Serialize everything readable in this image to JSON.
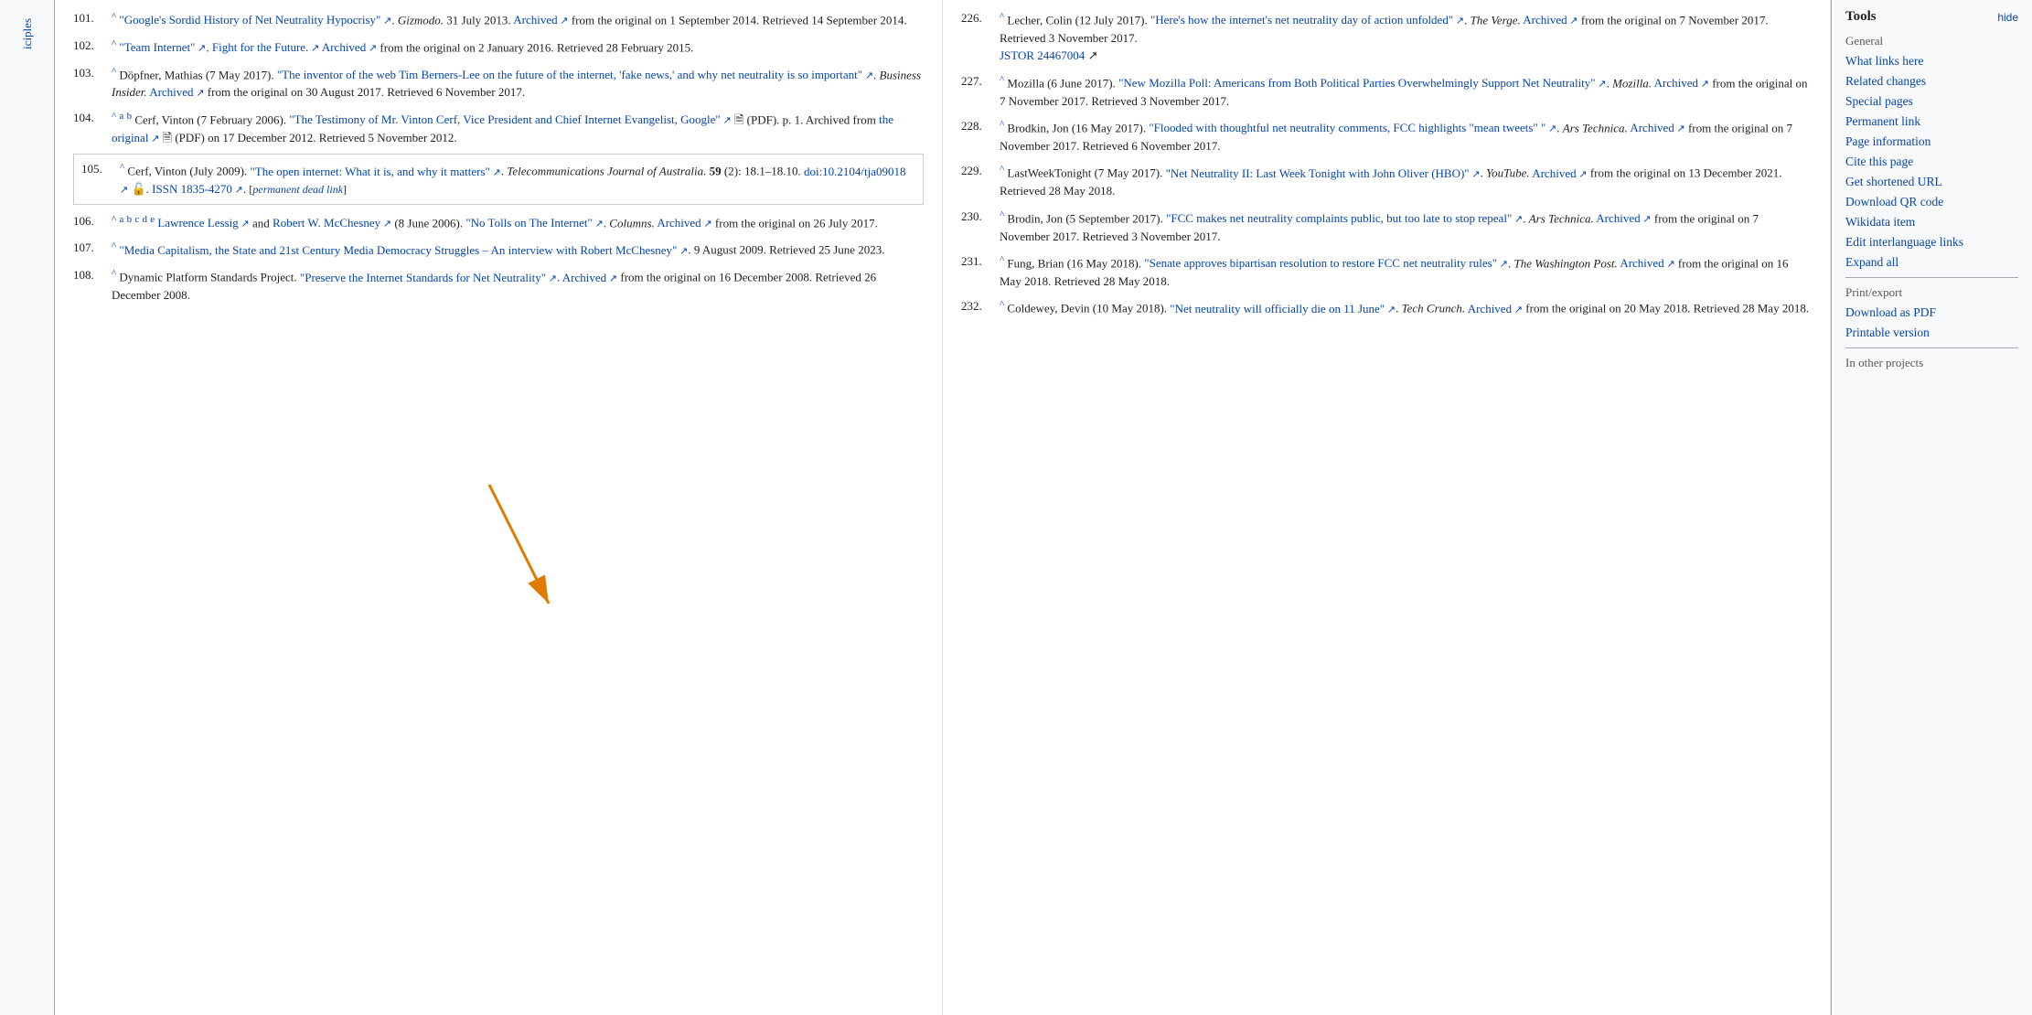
{
  "sidebar_left": {
    "label": "iciples"
  },
  "refs_left": [
    {
      "num": "101.",
      "sup": "^",
      "content": "\"Google's Sordid History of Net Neutrality Hypocrisy\"",
      "content_link": true,
      "italic_source": "Gizmodo.",
      "date": "31 July 2013.",
      "archived": "Archived",
      "archived_text": " from the original on 1 September 2014. Retrieved 14 September 2014."
    },
    {
      "num": "102.",
      "sup": "^",
      "content": "\"Team Internet\"",
      "italic_source": "",
      "extra": "Fight for the Future.",
      "archived": "Archived",
      "archived_text": " from the original on 2 January 2016. Retrieved 28 February 2015."
    },
    {
      "num": "103.",
      "sup": "^",
      "authors": "Döpfner, Mathias (7 May 2017).",
      "content": "\"The inventor of the web Tim Berners-Lee on the future of the internet, 'fake news,' and why net neutrality is so important\"",
      "italic_source": "Business Insider.",
      "archived": "Archived",
      "archived_text": " from the original on 30 August 2017. Retrieved 6 November 2017."
    },
    {
      "num": "104.",
      "sup": "^",
      "sup_letters": "a b",
      "authors": "Cerf, Vinton (7 February 2006).",
      "content": "\"The Testimony of Mr. Vinton Cerf, Vice President and Chief Internet Evangelist, Google\"",
      "pdf_note": "(PDF). p. 1.",
      "archived": "Archived from the",
      "original_link": "the original",
      "archived_text": "(PDF) on 17 December 2012. Retrieved 5 November 2012."
    },
    {
      "num": "105.",
      "highlighted": true,
      "sup": "^",
      "authors": "Cerf, Vinton (July 2009).",
      "content": "\"The open internet: What it is, and why it matters\"",
      "italic_source": "Telecommunications Journal of Australia.",
      "bold_vol": "59",
      "issue_pages": "(2): 18.1–18.10.",
      "doi": "doi:10.2104/tja09018",
      "issn": "ISSN 1835-4270",
      "dead_link": "permanent dead link"
    },
    {
      "num": "106.",
      "sup": "^",
      "sup_letters": "a b c d e",
      "authors1_link": "Lawrence Lessig",
      "authors2_link": "Robert W. McChesney",
      "date": "(8 June 2006).",
      "content": "\"No Tolls on The Internet\"",
      "italic_source": "Columns.",
      "archived": "Archived",
      "archived_text": " from the original on 26 July 2017."
    },
    {
      "num": "107.",
      "sup": "^",
      "content": "\"Media Capitalism, the State and 21st Century Media Democracy Struggles – An interview with Robert McChesney\"",
      "date": ". 9 August 2009. Retrieved 25 June 2023."
    },
    {
      "num": "108.",
      "sup": "^",
      "authors": "Dynamic Platform Standards Project.",
      "content": "\"Preserve the Internet Standards for Net Neutrality\"",
      "archived": "Archived",
      "archived_text": " from the original on 16 December 2008. Retrieved 26 December 2008."
    }
  ],
  "refs_right": [
    {
      "num": "226.",
      "sup": "^",
      "authors": "Lecher, Colin (12 July 2017).",
      "content": "\"Here's how the internet's net neutrality day of action unfolded\"",
      "italic_source": "The Verge.",
      "archived": "Archived",
      "archived_text": " from the original on 7 November 2017. Retrieved 3 November 2017.",
      "jstor": "JSTOR 24467004"
    },
    {
      "num": "227.",
      "sup": "^",
      "authors": "Mozilla (6 June 2017).",
      "content": "\"New Mozilla Poll: Americans from Both Political Parties Overwhelmingly Support Net Neutrality\"",
      "italic_source": "Mozilla.",
      "archived": "Archived",
      "archived_text": " from the original on 7 November 2017. Retrieved 3 November 2017."
    },
    {
      "num": "228.",
      "sup": "^",
      "authors": "Brodkin, Jon (16 May 2017).",
      "content": "\"Flooded with thoughtful net neutrality comments, FCC highlights \"mean tweets\" \"",
      "italic_source": "Ars Technica.",
      "archived": "Archived",
      "archived_text": " from the original on 7 November 2017. Retrieved 6 November 2017."
    },
    {
      "num": "229.",
      "sup": "^",
      "authors": "LastWeekTonight (7 May 2017).",
      "content": "\"Net Neutrality II: Last Week Tonight with John Oliver (HBO)\"",
      "italic_source": "YouTube.",
      "archived": "Archived",
      "archived_text": " from the original on 13 December 2021. Retrieved 28 May 2018."
    },
    {
      "num": "230.",
      "sup": "^",
      "authors": "Brodin, Jon (5 September 2017).",
      "content": "\"FCC makes net neutrality complaints public, but too late to stop repeal\"",
      "italic_source": "Ars Technica.",
      "archived": "Archived",
      "archived_text": " from the original on 7 November 2017. Retrieved 3 November 2017."
    },
    {
      "num": "231.",
      "sup": "^",
      "authors": "Fung, Brian (16 May 2018).",
      "content": "\"Senate approves bipartisan resolution to restore FCC net neutrality rules\"",
      "italic_source": "The Washington Post.",
      "archived": "Archived",
      "archived_text": " from the original on 16 May 2018. Retrieved 28 May 2018."
    },
    {
      "num": "232.",
      "sup": "^",
      "authors": "Coldewey, Devin (10 May 2018).",
      "content": "\"Net neutrality will officially die on 11 June\"",
      "italic_source": "Tech Crunch.",
      "archived": "Archived",
      "archived_text": " from the original on 20 May 2018. Retrieved 28 May 2018.",
      "truncated": true
    }
  ],
  "tools": {
    "title": "Tools",
    "hide_label": "hide",
    "general_label": "General",
    "links": [
      "What links here",
      "Related changes",
      "Special pages",
      "Permanent link",
      "Page information",
      "Cite this page",
      "Get shortened URL",
      "Download QR code",
      "Wikidata item",
      "Edit interlanguage links",
      "Expand all"
    ],
    "print_section": "Print/export",
    "print_links": [
      "Download as PDF",
      "Printable version"
    ],
    "other_section": "In other projects"
  }
}
